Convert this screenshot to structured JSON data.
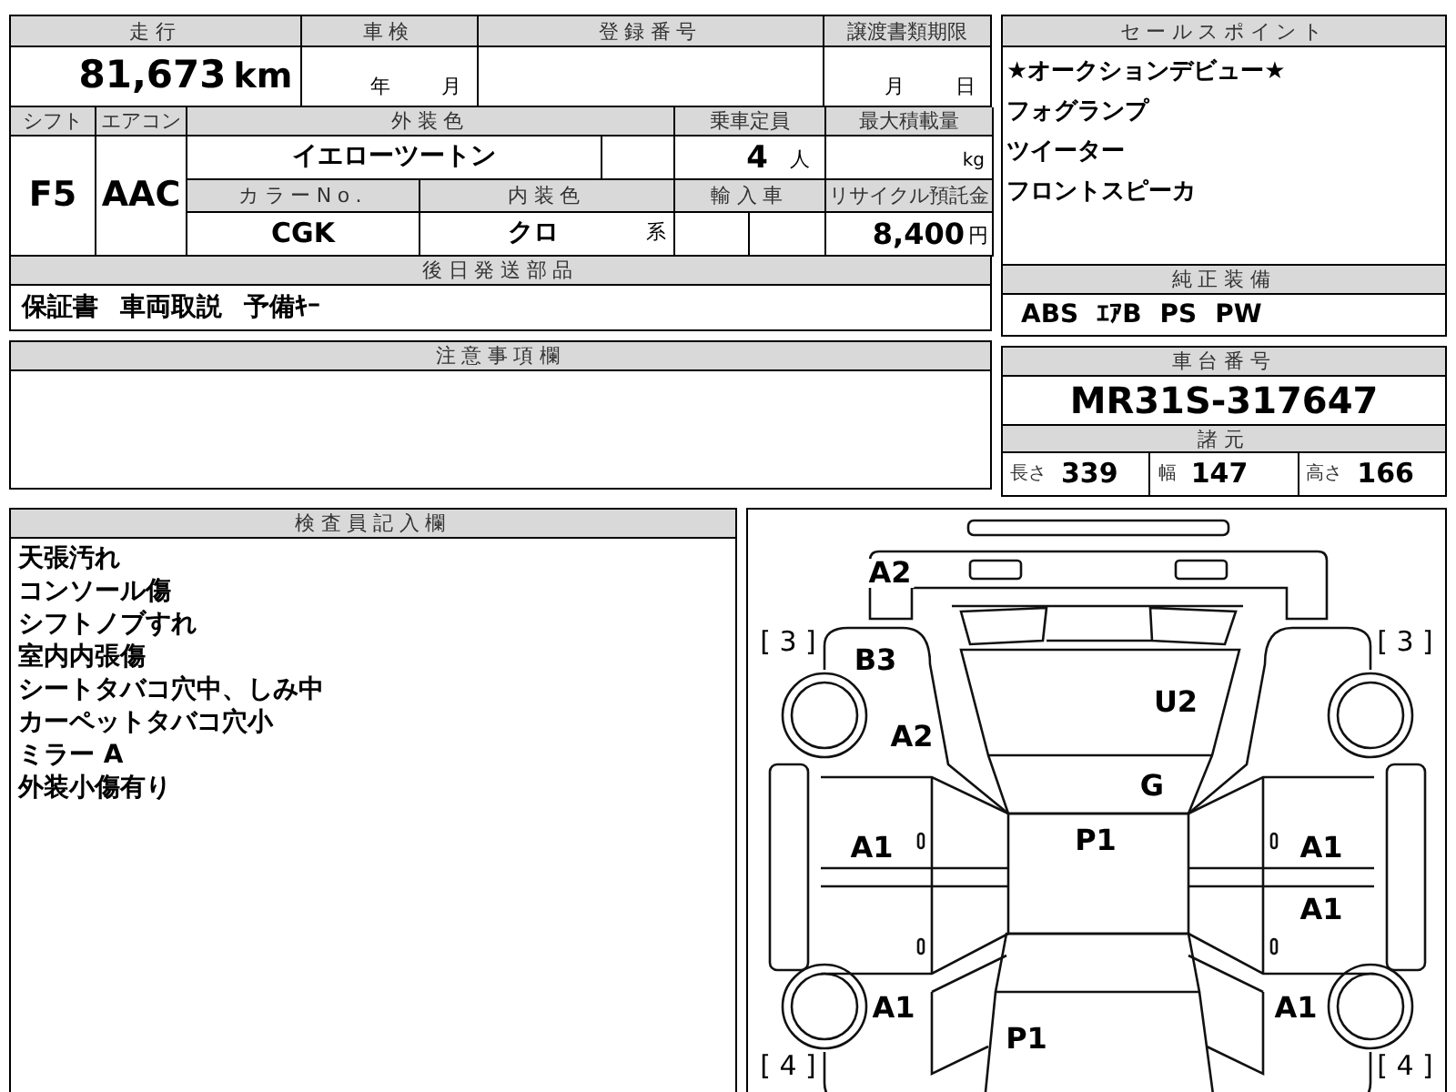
{
  "mileage": {
    "label": "走行",
    "value": "81,673",
    "unit": "km"
  },
  "inspection": {
    "label": "車検",
    "year": "年",
    "month": "月"
  },
  "registration": {
    "label": "登録番号"
  },
  "transfer_deadline": {
    "label": "譲渡書類期限",
    "month": "月",
    "day": "日"
  },
  "shift": {
    "label": "シフト",
    "value": "F5"
  },
  "aircon": {
    "label": "エアコン",
    "value": "AAC"
  },
  "exterior_color": {
    "label": "外装色",
    "value": "イエローツートン"
  },
  "capacity": {
    "label": "乗車定員",
    "value": "4",
    "unit": "人"
  },
  "max_load": {
    "label": "最大積載量",
    "unit": "kg"
  },
  "color_no": {
    "label": "カラーNo.",
    "value": "CGK"
  },
  "interior_color": {
    "label": "内装色",
    "value": "クロ",
    "suffix": "系"
  },
  "imported": {
    "label": "輸入車"
  },
  "recycling_fee": {
    "label": "リサイクル預託金",
    "value": "8,400",
    "unit": "円"
  },
  "later_parts": {
    "label": "後日発送部品",
    "items": [
      "保証書",
      "車両取説",
      "予備ｷｰ"
    ]
  },
  "notes": {
    "label": "注意事項欄"
  },
  "inspector_notes": {
    "label": "検査員記入欄",
    "lines": [
      "天張汚れ",
      "コンソール傷",
      "シフトノブすれ",
      "室内内張傷",
      "シートタバコ穴中、しみ中",
      "カーペットタバコ穴小",
      "ミラー A",
      "外装小傷有り"
    ]
  },
  "sales_points": {
    "label": "セールスポイント",
    "items": [
      "★オークションデビュー★",
      "フォグランプ",
      "ツイーター",
      "フロントスピーカ"
    ]
  },
  "standard_equipment": {
    "label": "純正装備",
    "items": [
      "ABS",
      "ｴｱB",
      "PS",
      "PW"
    ]
  },
  "chassis": {
    "label": "車台番号",
    "value": "MR31S-317647"
  },
  "specs": {
    "label": "諸元",
    "items": [
      {
        "label": "長さ",
        "value": "339"
      },
      {
        "label": "幅",
        "value": "147"
      },
      {
        "label": "高さ",
        "value": "166"
      }
    ]
  },
  "diagram": {
    "marks": [
      {
        "kind": "damage",
        "text": "A2"
      },
      {
        "kind": "grade",
        "text": "[ 3 ]"
      },
      {
        "kind": "grade",
        "text": "[ 3 ]"
      },
      {
        "kind": "damage",
        "text": "B3"
      },
      {
        "kind": "damage",
        "text": "U2"
      },
      {
        "kind": "damage",
        "text": "A2"
      },
      {
        "kind": "damage",
        "text": "G"
      },
      {
        "kind": "damage",
        "text": "A1"
      },
      {
        "kind": "damage",
        "text": "P1"
      },
      {
        "kind": "damage",
        "text": "A1"
      },
      {
        "kind": "damage",
        "text": "A1"
      },
      {
        "kind": "damage",
        "text": "A1"
      },
      {
        "kind": "damage",
        "text": "A1"
      },
      {
        "kind": "damage",
        "text": "P1"
      },
      {
        "kind": "grade",
        "text": "[ 4 ]"
      },
      {
        "kind": "grade",
        "text": "[ 4 ]"
      }
    ]
  }
}
